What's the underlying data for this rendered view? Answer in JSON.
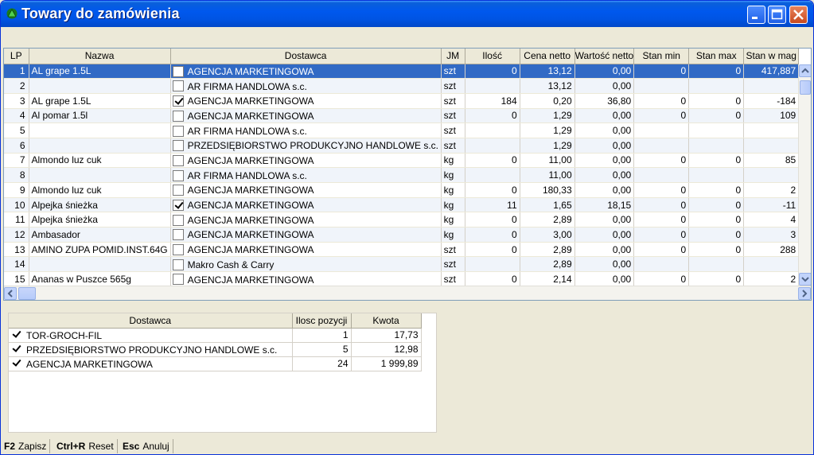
{
  "window": {
    "title": "Towary do zamówienia",
    "accent": "#0054e3",
    "icon": "green-triangle-icon"
  },
  "grid": {
    "columns": [
      "LP",
      "Nazwa",
      "Dostawca",
      "JM",
      "Ilość",
      "Cena netto",
      "Wartość netto",
      "Stan min",
      "Stan max",
      "Stan w mag"
    ],
    "selected_row": 1,
    "rows": [
      {
        "lp": "1",
        "nazwa": "AL grape 1.5L",
        "checked": false,
        "dostawca": "AGENCJA MARKETINGOWA",
        "jm": "szt",
        "ilosc": "0",
        "cena": "13,12",
        "wartosc": "0,00",
        "min": "0",
        "max": "0",
        "mag": "417,887"
      },
      {
        "lp": "2",
        "nazwa": "",
        "checked": false,
        "dostawca": "AR FIRMA HANDLOWA s.c.",
        "jm": "szt",
        "ilosc": "",
        "cena": "13,12",
        "wartosc": "0,00",
        "min": "",
        "max": "",
        "mag": ""
      },
      {
        "lp": "3",
        "nazwa": "AL grape 1.5L",
        "checked": true,
        "dostawca": "AGENCJA MARKETINGOWA",
        "jm": "szt",
        "ilosc": "184",
        "cena": "0,20",
        "wartosc": "36,80",
        "min": "0",
        "max": "0",
        "mag": "-184"
      },
      {
        "lp": "4",
        "nazwa": "Al pomar 1.5l",
        "checked": false,
        "dostawca": "AGENCJA MARKETINGOWA",
        "jm": "szt",
        "ilosc": "0",
        "cena": "1,29",
        "wartosc": "0,00",
        "min": "0",
        "max": "0",
        "mag": "109"
      },
      {
        "lp": "5",
        "nazwa": "",
        "checked": false,
        "dostawca": "AR FIRMA HANDLOWA s.c.",
        "jm": "szt",
        "ilosc": "",
        "cena": "1,29",
        "wartosc": "0,00",
        "min": "",
        "max": "",
        "mag": ""
      },
      {
        "lp": "6",
        "nazwa": "",
        "checked": false,
        "dostawca": "PRZEDSIĘBIORSTWO PRODUKCYJNO HANDLOWE s.c.",
        "jm": "szt",
        "ilosc": "",
        "cena": "1,29",
        "wartosc": "0,00",
        "min": "",
        "max": "",
        "mag": ""
      },
      {
        "lp": "7",
        "nazwa": "Almondo luz cuk",
        "checked": false,
        "dostawca": "AGENCJA MARKETINGOWA",
        "jm": "kg",
        "ilosc": "0",
        "cena": "11,00",
        "wartosc": "0,00",
        "min": "0",
        "max": "0",
        "mag": "85"
      },
      {
        "lp": "8",
        "nazwa": "",
        "checked": false,
        "dostawca": "AR FIRMA HANDLOWA s.c.",
        "jm": "kg",
        "ilosc": "",
        "cena": "11,00",
        "wartosc": "0,00",
        "min": "",
        "max": "",
        "mag": ""
      },
      {
        "lp": "9",
        "nazwa": "Almondo luz cuk",
        "checked": false,
        "dostawca": "AGENCJA MARKETINGOWA",
        "jm": "kg",
        "ilosc": "0",
        "cena": "180,33",
        "wartosc": "0,00",
        "min": "0",
        "max": "0",
        "mag": "2"
      },
      {
        "lp": "10",
        "nazwa": "Alpejka śnieżka",
        "checked": true,
        "dostawca": "AGENCJA MARKETINGOWA",
        "jm": "kg",
        "ilosc": "11",
        "cena": "1,65",
        "wartosc": "18,15",
        "min": "0",
        "max": "0",
        "mag": "-11"
      },
      {
        "lp": "11",
        "nazwa": "Alpejka śnieżka",
        "checked": false,
        "dostawca": "AGENCJA MARKETINGOWA",
        "jm": "kg",
        "ilosc": "0",
        "cena": "2,89",
        "wartosc": "0,00",
        "min": "0",
        "max": "0",
        "mag": "4"
      },
      {
        "lp": "12",
        "nazwa": "Ambasador",
        "checked": false,
        "dostawca": "AGENCJA MARKETINGOWA",
        "jm": "kg",
        "ilosc": "0",
        "cena": "3,00",
        "wartosc": "0,00",
        "min": "0",
        "max": "0",
        "mag": "3"
      },
      {
        "lp": "13",
        "nazwa": "AMINO ZUPA POMID.INST.64G",
        "checked": false,
        "dostawca": "AGENCJA MARKETINGOWA",
        "jm": "szt",
        "ilosc": "0",
        "cena": "2,89",
        "wartosc": "0,00",
        "min": "0",
        "max": "0",
        "mag": "288"
      },
      {
        "lp": "14",
        "nazwa": "",
        "checked": false,
        "dostawca": "Makro Cash & Carry",
        "jm": "szt",
        "ilosc": "",
        "cena": "2,89",
        "wartosc": "0,00",
        "min": "",
        "max": "",
        "mag": ""
      },
      {
        "lp": "15",
        "nazwa": "Ananas w Puszce 565g",
        "checked": false,
        "dostawca": "AGENCJA MARKETINGOWA",
        "jm": "szt",
        "ilosc": "0",
        "cena": "2,14",
        "wartosc": "0,00",
        "min": "0",
        "max": "0",
        "mag": "2"
      }
    ]
  },
  "summary": {
    "columns": [
      "Dostawca",
      "Ilosc pozycji",
      "Kwota"
    ],
    "rows": [
      {
        "checked": true,
        "dostawca": "TOR-GROCH-FIL",
        "ilosc": "1",
        "kwota": "17,73"
      },
      {
        "checked": true,
        "dostawca": "PRZEDSIĘBIORSTWO PRODUKCYJNO HANDLOWE s.c.",
        "ilosc": "5",
        "kwota": "12,98"
      },
      {
        "checked": true,
        "dostawca": "AGENCJA MARKETINGOWA",
        "ilosc": "24",
        "kwota": "1 999,89"
      }
    ]
  },
  "statusbar": {
    "items": [
      {
        "key": "F2",
        "label": "Zapisz"
      },
      {
        "key": "Ctrl+R",
        "label": "Reset"
      },
      {
        "key": "Esc",
        "label": "Anuluj"
      }
    ]
  }
}
